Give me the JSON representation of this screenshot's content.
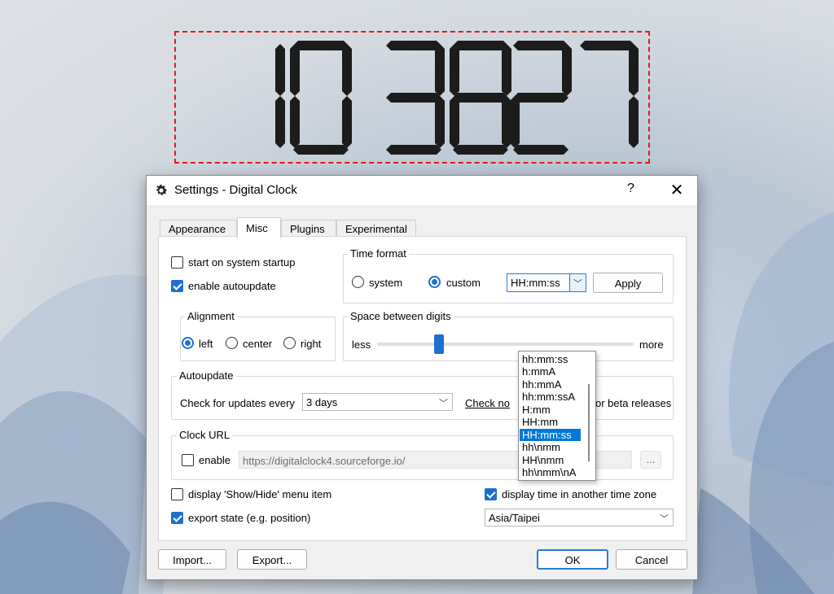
{
  "clock": {
    "digits": "103827"
  },
  "dialog": {
    "title": "Settings - Digital Clock",
    "help": "?",
    "close": "✕"
  },
  "tabs": [
    "Appearance",
    "Misc",
    "Plugins",
    "Experimental"
  ],
  "active_tab": "Misc",
  "misc": {
    "start_on_startup": {
      "label": "start on system startup",
      "checked": false
    },
    "enable_autoupdate": {
      "label": "enable autoupdate",
      "checked": true
    },
    "time_format": {
      "group_label": "Time format",
      "system_label": "system",
      "custom_label": "custom",
      "custom_selected": true,
      "value": "HH:mm:ss",
      "apply_label": "Apply",
      "options": [
        "hh:mm:ss",
        "h:mmA",
        "hh:mmA",
        "hh:mm:ssA",
        "H:mm",
        "HH:mm",
        "HH:mm:ss",
        "hh\\nmm",
        "HH\\nmm",
        "hh\\nmm\\nA"
      ],
      "selected_option": "HH:mm:ss"
    },
    "alignment": {
      "group_label": "Alignment",
      "left_label": "left",
      "center_label": "center",
      "right_label": "right",
      "selected": "left"
    },
    "space_between_digits": {
      "group_label": "Space between digits",
      "less_label": "less",
      "more_label": "more"
    },
    "autoupdate": {
      "group_label": "Autoupdate",
      "check_label": "Check for updates every",
      "interval": "3 days",
      "check_now_label": "Check no",
      "beta_label": "or beta releases"
    },
    "clock_url": {
      "group_label": "Clock URL",
      "enable_label": "enable",
      "enabled": false,
      "url": "https://digitalclock4.sourceforge.io/",
      "browse_label": "..."
    },
    "show_hide": {
      "label": "display 'Show/Hide' menu item",
      "checked": false
    },
    "export_state": {
      "label": "export state (e.g. position)",
      "checked": true
    },
    "other_timezone": {
      "label": "display time in another time zone",
      "checked": true
    },
    "timezone": "Asia/Taipei"
  },
  "footer": {
    "import_label": "Import...",
    "export_label": "Export...",
    "ok_label": "OK",
    "cancel_label": "Cancel"
  },
  "colors": {
    "accent": "#1f6fd0",
    "selection": "#0078d7",
    "clock_digits": "#1c1c1c",
    "clock_border": "#e01b1b"
  }
}
